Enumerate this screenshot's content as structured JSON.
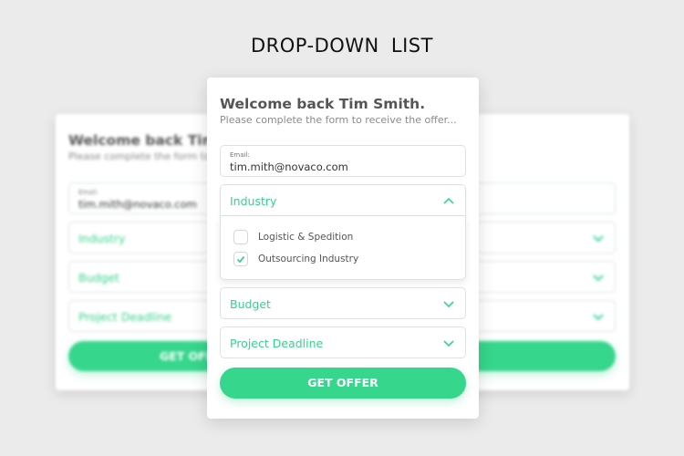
{
  "page": {
    "title": "DROP-DOWN  LIST"
  },
  "colors": {
    "accent": "#36d68c",
    "background": "#ebebeb",
    "card": "#ffffff",
    "border": "#dde1e6"
  },
  "form": {
    "welcome": "Welcome back Tim Smith.",
    "subtitle": "Please complete the form to receive the offer...",
    "email": {
      "label": "Email:",
      "value": "tim.mith@novaco.com"
    },
    "industry": {
      "placeholder": "Industry",
      "state": "open",
      "icon": "chevron-up-icon",
      "options": [
        {
          "label": "Logistic & Spedition",
          "checked": false
        },
        {
          "label": "Outsourcing Industry",
          "checked": true
        }
      ]
    },
    "budget": {
      "placeholder": "Budget",
      "icon": "chevron-down-icon"
    },
    "deadline": {
      "placeholder": "Project Deadline",
      "icon": "chevron-down-icon"
    },
    "submit_label": "GET OFFER"
  }
}
